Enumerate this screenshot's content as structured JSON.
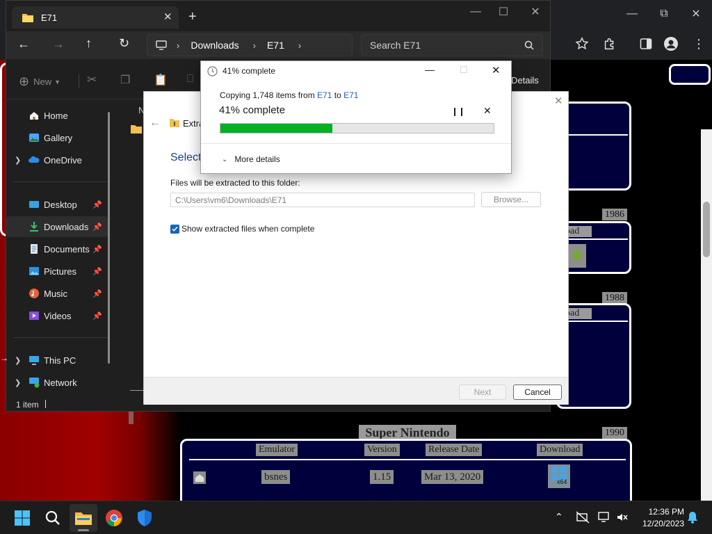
{
  "explorer": {
    "tab_title": "E71",
    "breadcrumb": [
      "Downloads",
      "E71"
    ],
    "search_placeholder": "Search E71",
    "cmd": {
      "new_label": "New",
      "details_label": "Details"
    },
    "column_header_partial": "N",
    "nav": {
      "home": "Home",
      "gallery": "Gallery",
      "onedrive": "OneDrive",
      "desktop": "Desktop",
      "downloads": "Downloads",
      "documents": "Documents",
      "pictures": "Pictures",
      "music": "Music",
      "videos": "Videos",
      "this_pc": "This PC",
      "network": "Network"
    },
    "status": "1 item"
  },
  "wizard": {
    "title_partial": "Extra",
    "heading_partial": "Select",
    "folder_label": "Files will be extracted to this folder:",
    "path_value": "C:\\Users\\vm6\\Downloads\\E71",
    "browse_label": "Browse...",
    "checkbox_label": "Show extracted files when complete",
    "checkbox_checked": true,
    "next_label": "Next",
    "cancel_label": "Cancel"
  },
  "progress": {
    "title": "41% complete",
    "copy_prefix": "Copying 1,748 items from ",
    "source": "E71",
    "to_word": " to ",
    "dest": "E71",
    "percent_text": "41% complete",
    "percent_value": 0.41,
    "more_details": "More details",
    "bar_color": "#06b025"
  },
  "webpage": {
    "years": [
      "1986",
      "1988",
      "1990"
    ],
    "partial_download_1": "oad",
    "partial_download_2": "oad",
    "section_title": "Super Nintendo",
    "table_headers": [
      "Emulator",
      "Version",
      "Release Date",
      "Download"
    ],
    "row": {
      "emulator": "bsnes",
      "version": "1.15",
      "release_date": "Mar 13, 2020",
      "badge": "x64"
    }
  },
  "taskbar": {
    "time": "12:36 PM",
    "date": "12/20/2023"
  }
}
